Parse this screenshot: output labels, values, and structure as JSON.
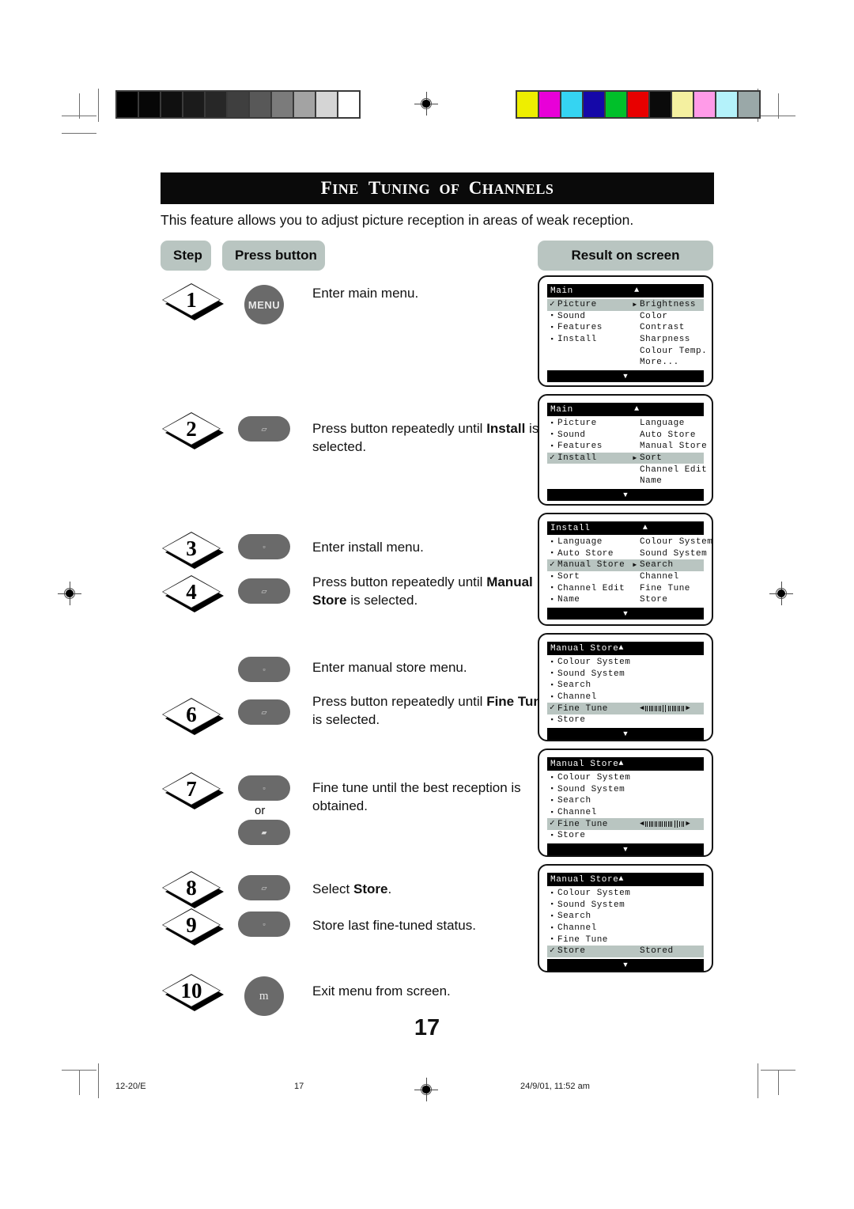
{
  "page": {
    "title": "FINE TUNING OF CHANNELS",
    "title_words": [
      "Fine",
      "Tuning",
      "of",
      "Channels"
    ],
    "intro": "This feature allows you to adjust picture reception in areas of weak reception.",
    "page_number": "17"
  },
  "headers": {
    "step": "Step",
    "press_button": "Press button",
    "result": "Result on screen"
  },
  "steps": [
    {
      "number": "1",
      "button_label": "MENU",
      "button_glyph": "",
      "description_prefix": "Enter main menu.",
      "description_bold": "",
      "description_suffix": ""
    },
    {
      "number": "2",
      "button_label": "",
      "button_glyph": "▱",
      "description_prefix": "Press button repeatedly until ",
      "description_bold": "Install",
      "description_suffix": " is selected."
    },
    {
      "number": "3",
      "button_label": "",
      "button_glyph": "▫",
      "description_prefix": "Enter install menu.",
      "description_bold": "",
      "description_suffix": ""
    },
    {
      "number": "4",
      "button_label": "",
      "button_glyph": "▱",
      "description_prefix": "Press button repeatedly until ",
      "description_bold": "Manual Store",
      "description_suffix": " is selected."
    },
    {
      "number": "",
      "button_label": "",
      "button_glyph": "▫",
      "description_prefix": "Enter manual store menu.",
      "description_bold": "",
      "description_suffix": ""
    },
    {
      "number": "6",
      "button_label": "",
      "button_glyph": "▱",
      "description_prefix": "Press button repeatedly until ",
      "description_bold": "Fine Tune",
      "description_suffix": " is selected."
    },
    {
      "number": "7",
      "button_label": "",
      "button_glyph": "▫",
      "description_prefix": "Fine tune until the best reception is obtained.",
      "description_bold": "",
      "description_suffix": "",
      "or_label": "or",
      "button2_glyph": "▰"
    },
    {
      "number": "8",
      "button_label": "",
      "button_glyph": "▱",
      "description_prefix": "Select ",
      "description_bold": "Store",
      "description_suffix": "."
    },
    {
      "number": "9",
      "button_label": "",
      "button_glyph": "▫",
      "description_prefix": "Store last fine-tuned status.",
      "description_bold": "",
      "description_suffix": ""
    },
    {
      "number": "10",
      "button_label": "m",
      "button_glyph": "",
      "description_prefix": "Exit menu from screen.",
      "description_bold": "",
      "description_suffix": ""
    }
  ],
  "osd_screens": [
    {
      "header_title": "Main",
      "header_caret": "▲",
      "header_caret_attached": false,
      "rows": [
        {
          "marker": "check",
          "left": "Picture",
          "arrow": "▶",
          "right": "Brightness",
          "selected": true
        },
        {
          "marker": "sq",
          "left": "Sound",
          "arrow": "",
          "right": "Color",
          "selected": false
        },
        {
          "marker": "sq",
          "left": "Features",
          "arrow": "",
          "right": "Contrast",
          "selected": false
        },
        {
          "marker": "sq",
          "left": "Install",
          "arrow": "",
          "right": "Sharpness",
          "selected": false
        },
        {
          "marker": "",
          "left": "",
          "arrow": "",
          "right": "Colour Temp.",
          "selected": false
        },
        {
          "marker": "",
          "left": "",
          "arrow": "",
          "right": "More...",
          "selected": false
        }
      ],
      "footer_caret": "▼"
    },
    {
      "header_title": "Main",
      "header_caret": "▲",
      "header_caret_attached": false,
      "rows": [
        {
          "marker": "sq",
          "left": "Picture",
          "arrow": "",
          "right": "Language",
          "selected": false
        },
        {
          "marker": "sq",
          "left": "Sound",
          "arrow": "",
          "right": "Auto Store",
          "selected": false
        },
        {
          "marker": "sq",
          "left": "Features",
          "arrow": "",
          "right": "Manual Store",
          "selected": false
        },
        {
          "marker": "check",
          "left": "Install",
          "arrow": "▶",
          "right": "Sort",
          "selected": true
        },
        {
          "marker": "",
          "left": "",
          "arrow": "",
          "right": "Channel Edit",
          "selected": false
        },
        {
          "marker": "",
          "left": "",
          "arrow": "",
          "right": "Name",
          "selected": false
        }
      ],
      "footer_caret": "▼"
    },
    {
      "header_title": "Install",
      "header_caret": "▲",
      "header_caret_attached": false,
      "rows": [
        {
          "marker": "sq",
          "left": "Language",
          "arrow": "",
          "right": "Colour System",
          "selected": false
        },
        {
          "marker": "sq",
          "left": "Auto Store",
          "arrow": "",
          "right": "Sound System",
          "selected": false
        },
        {
          "marker": "check",
          "left": "Manual Store",
          "arrow": "▶",
          "right": "Search",
          "selected": true
        },
        {
          "marker": "sq",
          "left": "Sort",
          "arrow": "",
          "right": "Channel",
          "selected": false
        },
        {
          "marker": "sq",
          "left": "Channel Edit",
          "arrow": "",
          "right": "Fine Tune",
          "selected": false
        },
        {
          "marker": "sq",
          "left": "Name",
          "arrow": "",
          "right": "Store",
          "selected": false
        }
      ],
      "footer_caret": "▼"
    },
    {
      "header_title": "Manual Store",
      "header_caret": "▲",
      "header_caret_attached": true,
      "rows": [
        {
          "marker": "sq",
          "left": "Colour System",
          "arrow": "",
          "right": "",
          "selected": false
        },
        {
          "marker": "sq",
          "left": "Sound System",
          "arrow": "",
          "right": "",
          "selected": false
        },
        {
          "marker": "sq",
          "left": "Search",
          "arrow": "",
          "right": "",
          "selected": false
        },
        {
          "marker": "sq",
          "left": "Channel",
          "arrow": "",
          "right": "",
          "selected": false
        },
        {
          "marker": "check",
          "left": "Fine Tune",
          "arrow": "",
          "right": "",
          "selected": true,
          "slider": {
            "position": 50,
            "left_arrow": "◀",
            "right_arrow": "▶",
            "ticks_left": 9,
            "ticks_right": 9
          }
        },
        {
          "marker": "sq",
          "left": "Store",
          "arrow": "",
          "right": "",
          "selected": false
        }
      ],
      "footer_caret": "▼"
    },
    {
      "header_title": "Manual Store",
      "header_caret": "▲",
      "header_caret_attached": true,
      "rows": [
        {
          "marker": "sq",
          "left": "Colour System",
          "arrow": "",
          "right": "",
          "selected": false
        },
        {
          "marker": "sq",
          "left": "Sound System",
          "arrow": "",
          "right": "",
          "selected": false
        },
        {
          "marker": "sq",
          "left": "Search",
          "arrow": "",
          "right": "",
          "selected": false
        },
        {
          "marker": "sq",
          "left": "Channel",
          "arrow": "",
          "right": "",
          "selected": false
        },
        {
          "marker": "check",
          "left": "Fine Tune",
          "arrow": "",
          "right": "",
          "selected": true,
          "slider": {
            "position": 80,
            "left_arrow": "◀",
            "right_arrow": "▶",
            "ticks_left": 15,
            "ticks_right": 3
          }
        },
        {
          "marker": "sq",
          "left": "Store",
          "arrow": "",
          "right": "",
          "selected": false
        }
      ],
      "footer_caret": "▼"
    },
    {
      "header_title": "Manual Store",
      "header_caret": "▲",
      "header_caret_attached": true,
      "rows": [
        {
          "marker": "sq",
          "left": "Colour System",
          "arrow": "",
          "right": "",
          "selected": false
        },
        {
          "marker": "sq",
          "left": "Sound System",
          "arrow": "",
          "right": "",
          "selected": false
        },
        {
          "marker": "sq",
          "left": "Search",
          "arrow": "",
          "right": "",
          "selected": false
        },
        {
          "marker": "sq",
          "left": "Channel",
          "arrow": "",
          "right": "",
          "selected": false
        },
        {
          "marker": "sq",
          "left": "Fine Tune",
          "arrow": "",
          "right": "",
          "selected": false
        },
        {
          "marker": "check",
          "left": "Store",
          "arrow": "",
          "right": "Stored",
          "selected": true
        }
      ],
      "footer_caret": "▼"
    }
  ],
  "print_marks": {
    "grey_wedge": [
      "#000000",
      "#070707",
      "#101010",
      "#1b1b1b",
      "#272727",
      "#3f3f3f",
      "#585858",
      "#7b7b7b",
      "#a3a3a3",
      "#d5d5d5",
      "#ffffff"
    ],
    "colour_bars": [
      "#eeee00",
      "#e800d8",
      "#35d4f2",
      "#1508a8",
      "#00c02a",
      "#e80000",
      "#0a0a0a",
      "#f4f0a0",
      "#ff9be8",
      "#b4f2fa",
      "#9aa8a8"
    ]
  },
  "footer": {
    "job_code": "12-20/E",
    "folio": "17",
    "timestamp": "24/9/01, 11:52 am"
  }
}
